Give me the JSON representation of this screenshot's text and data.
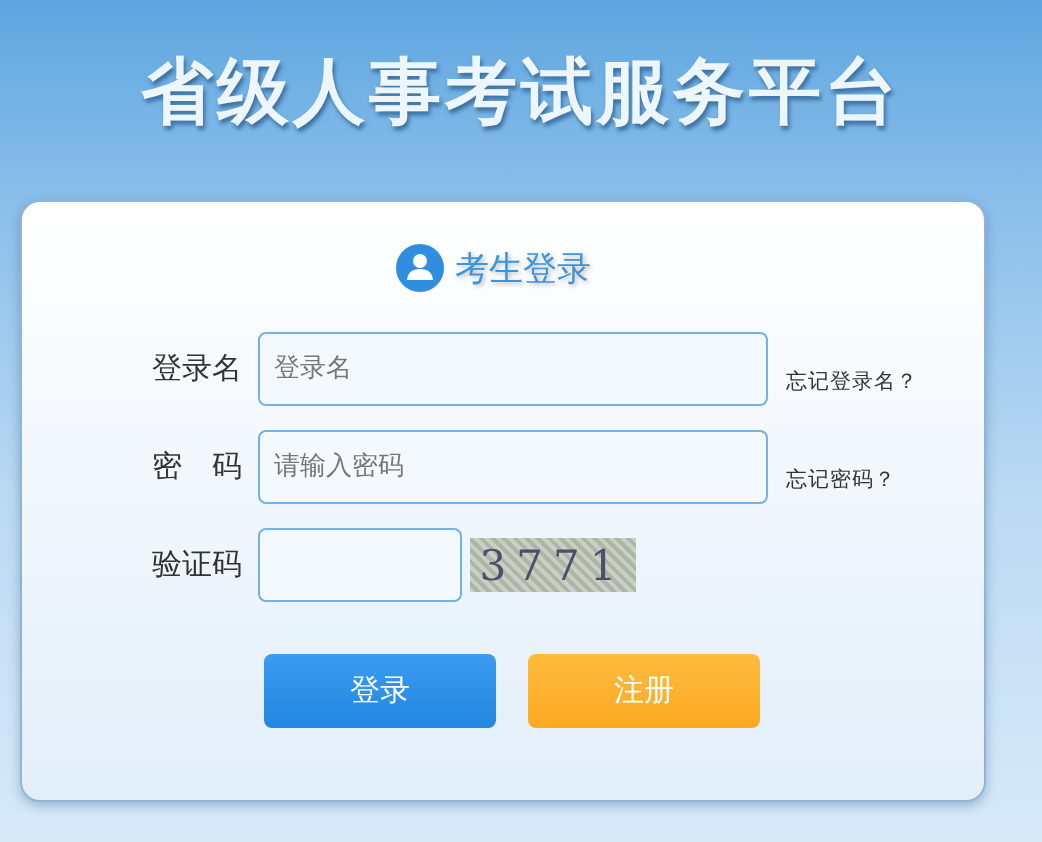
{
  "header": {
    "title": "省级人事考试服务平台"
  },
  "login": {
    "heading": "考生登录",
    "fields": [
      {
        "kind": "text",
        "label": "登录名",
        "placeholder": "登录名",
        "link": "忘记登录名？"
      },
      {
        "kind": "password",
        "label": "密　码",
        "placeholder": "请输入密码",
        "link": "忘记密码？"
      },
      {
        "kind": "captcha",
        "label": "验证码",
        "captcha": "3771"
      }
    ],
    "buttons": [
      {
        "kind": "primary",
        "label": "登录"
      },
      {
        "kind": "secondary",
        "label": "注册"
      }
    ]
  }
}
